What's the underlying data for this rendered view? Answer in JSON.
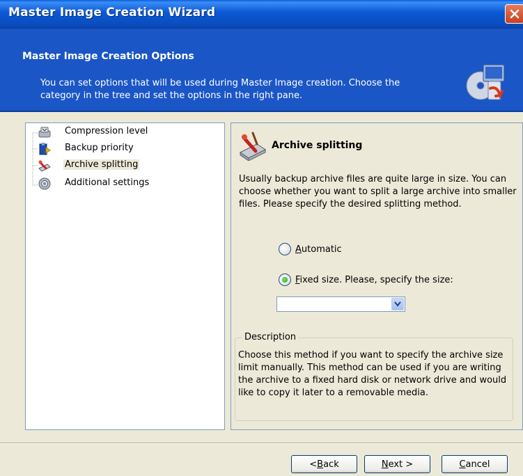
{
  "window": {
    "title": "Master Image Creation Wizard"
  },
  "header": {
    "title": "Master Image Creation Options",
    "description": "You can set options that will be used during Master Image creation. Choose the category in the tree and set the options in the right pane."
  },
  "tree": {
    "items": [
      {
        "label": "Compression level",
        "icon": "compression-icon"
      },
      {
        "label": "Backup priority",
        "icon": "priority-icon"
      },
      {
        "label": "Archive splitting",
        "icon": "archive-splitting-icon",
        "selected": true
      },
      {
        "label": "Additional settings",
        "icon": "gear-icon"
      }
    ]
  },
  "options": {
    "title": "Archive splitting",
    "description": "Usually backup archive files are quite large in size. You can choose whether you want to split a large archive into smaller files. Please specify the desired splitting method.",
    "radio_automatic": {
      "mnemonic": "A",
      "rest": "utomatic",
      "checked": false
    },
    "radio_fixed": {
      "mnemonic": "F",
      "rest": "ixed size. Please, specify the size:",
      "checked": true
    },
    "size_value": "",
    "desc_legend": "Description",
    "desc_text": "Choose this method if you want to specify the archive size limit manually. This method can be used if you are writing the archive to a fixed hard disk or network drive and would like to copy it later to a removable media."
  },
  "buttons": {
    "back": {
      "prefix": "< ",
      "mnemonic": "B",
      "rest": "ack"
    },
    "next": {
      "mnemonic": "N",
      "rest": "ext >"
    },
    "cancel": {
      "mnemonic": "C",
      "rest": "ancel"
    }
  },
  "colors": {
    "title_bar": "#0b58d4",
    "header": "#1b56c6",
    "window_bg": "#ece9d8"
  }
}
